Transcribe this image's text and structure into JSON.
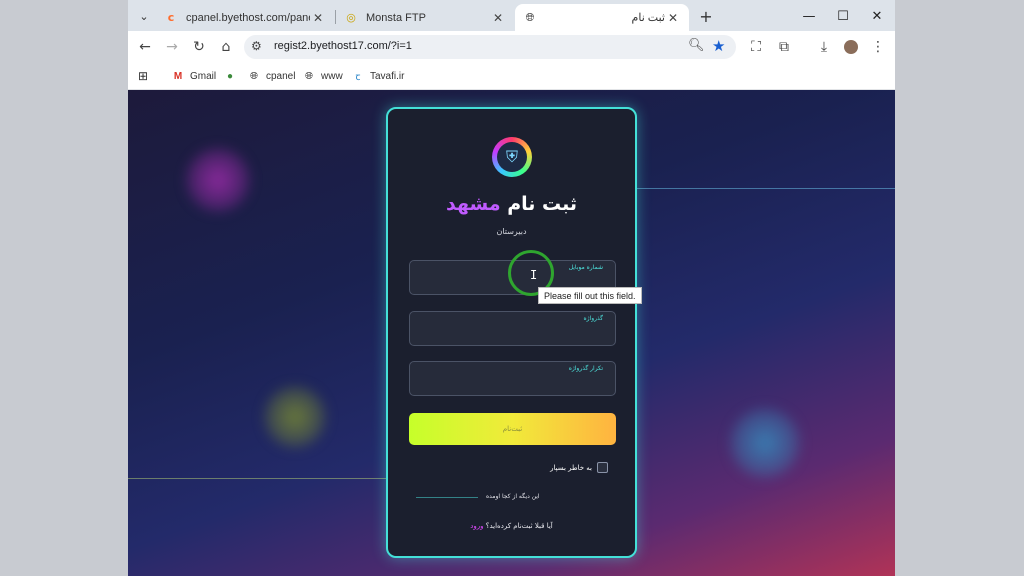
{
  "tabs": [
    {
      "title": "cpanel.byethost.com/panel/ind",
      "favicon": "cpanel-icon"
    },
    {
      "title": "Monsta FTP",
      "favicon": "monsta-icon"
    },
    {
      "title": "ثبت نام",
      "favicon": "globe-icon"
    }
  ],
  "toolbar": {
    "url": "regist2.byethost17.com/?i=1"
  },
  "bookmarks": [
    {
      "label": "Gmail",
      "icon": "gmail-icon"
    },
    {
      "label": "",
      "icon": "turtle-icon"
    },
    {
      "label": "cpanel",
      "icon": "globe-icon"
    },
    {
      "label": "www",
      "icon": "globe-icon"
    },
    {
      "label": "Tavafi.ir",
      "icon": "tavafi-icon"
    }
  ],
  "form": {
    "title_main": "ثبت نام",
    "title_accent": "مشهد",
    "subtitle": "دبیرستان",
    "fields": [
      {
        "label": "شماره موبایل"
      },
      {
        "label": "گذرواژه"
      },
      {
        "label": "تکرار گذرواژه"
      }
    ],
    "submit_label": "ثبت‌نام",
    "remember_label": "به خاطر بسپار",
    "separator_text": "این دیگه از کجا اومده",
    "login_question": "آیا قبلا ثبت‌نام کرده‌اید؟",
    "login_link": "ورود"
  },
  "tooltip": "Please fill out this field.",
  "colors": {
    "card_border": "#44e0d8",
    "title_accent": "#c05bff",
    "label_cyan": "#4ee6e0",
    "link_magenta": "#e04bff"
  }
}
